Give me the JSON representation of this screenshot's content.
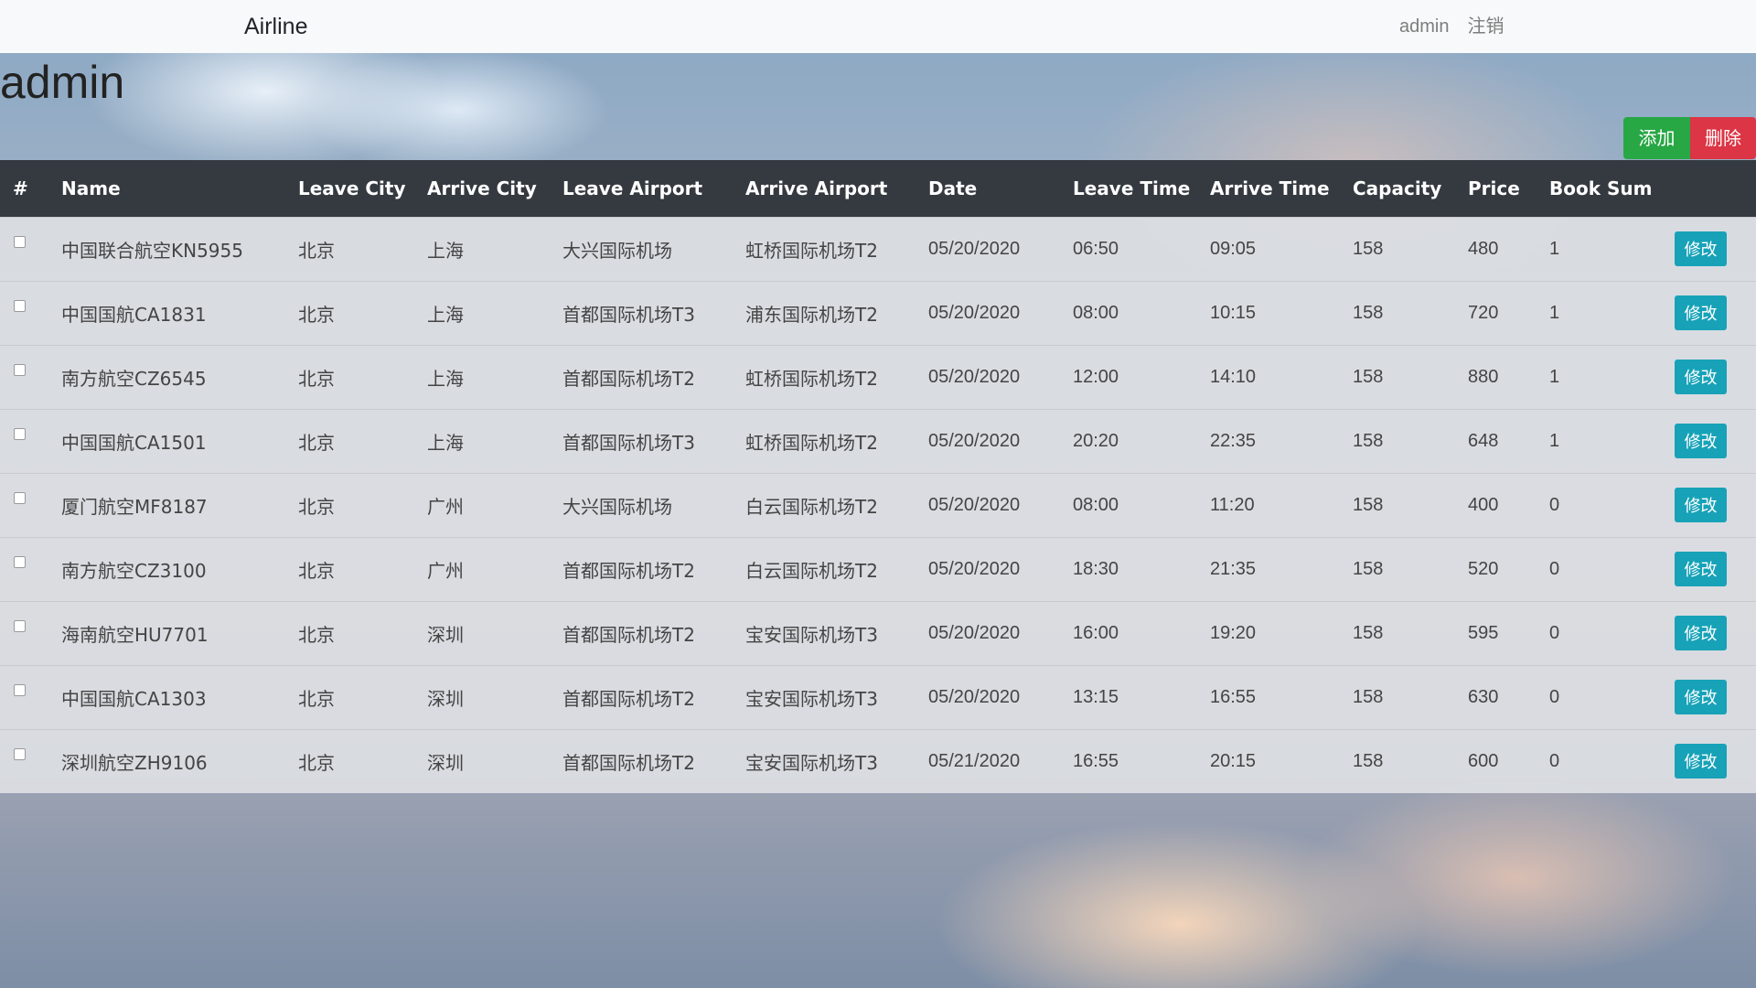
{
  "navbar": {
    "brand": "Airline",
    "user": "admin",
    "logout": "注销"
  },
  "header": {
    "title": "admin",
    "add_label": "添加",
    "delete_label": "删除"
  },
  "table": {
    "columns": [
      "#",
      "Name",
      "Leave City",
      "Arrive City",
      "Leave Airport",
      "Arrive Airport",
      "Date",
      "Leave Time",
      "Arrive Time",
      "Capacity",
      "Price",
      "Book Sum",
      ""
    ],
    "edit_label": "修改",
    "rows": [
      {
        "name": "中国联合航空KN5955",
        "leave_city": "北京",
        "arrive_city": "上海",
        "leave_airport": "大兴国际机场",
        "arrive_airport": "虹桥国际机场T2",
        "date": "05/20/2020",
        "leave_time": "06:50",
        "arrive_time": "09:05",
        "capacity": "158",
        "price": "480",
        "book_sum": "1"
      },
      {
        "name": "中国国航CA1831",
        "leave_city": "北京",
        "arrive_city": "上海",
        "leave_airport": "首都国际机场T3",
        "arrive_airport": "浦东国际机场T2",
        "date": "05/20/2020",
        "leave_time": "08:00",
        "arrive_time": "10:15",
        "capacity": "158",
        "price": "720",
        "book_sum": "1"
      },
      {
        "name": "南方航空CZ6545",
        "leave_city": "北京",
        "arrive_city": "上海",
        "leave_airport": "首都国际机场T2",
        "arrive_airport": "虹桥国际机场T2",
        "date": "05/20/2020",
        "leave_time": "12:00",
        "arrive_time": "14:10",
        "capacity": "158",
        "price": "880",
        "book_sum": "1"
      },
      {
        "name": "中国国航CA1501",
        "leave_city": "北京",
        "arrive_city": "上海",
        "leave_airport": "首都国际机场T3",
        "arrive_airport": "虹桥国际机场T2",
        "date": "05/20/2020",
        "leave_time": "20:20",
        "arrive_time": "22:35",
        "capacity": "158",
        "price": "648",
        "book_sum": "1"
      },
      {
        "name": "厦门航空MF8187",
        "leave_city": "北京",
        "arrive_city": "广州",
        "leave_airport": "大兴国际机场",
        "arrive_airport": "白云国际机场T2",
        "date": "05/20/2020",
        "leave_time": "08:00",
        "arrive_time": "11:20",
        "capacity": "158",
        "price": "400",
        "book_sum": "0"
      },
      {
        "name": "南方航空CZ3100",
        "leave_city": "北京",
        "arrive_city": "广州",
        "leave_airport": "首都国际机场T2",
        "arrive_airport": "白云国际机场T2",
        "date": "05/20/2020",
        "leave_time": "18:30",
        "arrive_time": "21:35",
        "capacity": "158",
        "price": "520",
        "book_sum": "0"
      },
      {
        "name": "海南航空HU7701",
        "leave_city": "北京",
        "arrive_city": "深圳",
        "leave_airport": "首都国际机场T2",
        "arrive_airport": "宝安国际机场T3",
        "date": "05/20/2020",
        "leave_time": "16:00",
        "arrive_time": "19:20",
        "capacity": "158",
        "price": "595",
        "book_sum": "0"
      },
      {
        "name": "中国国航CA1303",
        "leave_city": "北京",
        "arrive_city": "深圳",
        "leave_airport": "首都国际机场T2",
        "arrive_airport": "宝安国际机场T3",
        "date": "05/20/2020",
        "leave_time": "13:15",
        "arrive_time": "16:55",
        "capacity": "158",
        "price": "630",
        "book_sum": "0"
      },
      {
        "name": "深圳航空ZH9106",
        "leave_city": "北京",
        "arrive_city": "深圳",
        "leave_airport": "首都国际机场T2",
        "arrive_airport": "宝安国际机场T3",
        "date": "05/21/2020",
        "leave_time": "16:55",
        "arrive_time": "20:15",
        "capacity": "158",
        "price": "600",
        "book_sum": "0"
      }
    ]
  }
}
